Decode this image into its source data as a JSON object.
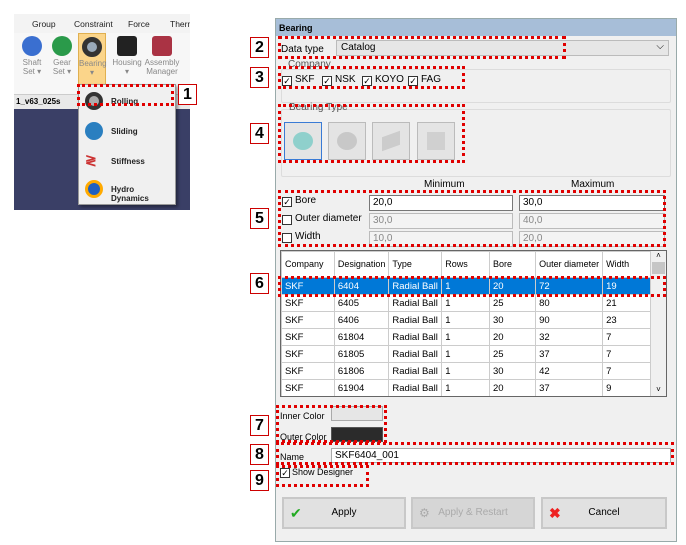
{
  "ribbon": {
    "tabs": [
      "Group",
      "Constraint",
      "Force",
      "Therm"
    ],
    "buttons": [
      {
        "label": "Shaft Set ▾",
        "icon": "shaft-icon"
      },
      {
        "label": "Gear Set ▾",
        "icon": "gear-icon"
      },
      {
        "label": "Bearing ▾",
        "icon": "bearing-icon"
      },
      {
        "label": "Housing ▾",
        "icon": "housing-icon"
      },
      {
        "label": "Assembly Manager",
        "icon": "assembly-icon"
      }
    ],
    "doc_tab": "1_v63_025s",
    "menu": [
      "Rolling",
      "Sliding",
      "Stiffness",
      "Hydro Dynamics"
    ]
  },
  "dialog": {
    "title": "Bearing",
    "data_type_label": "Data type",
    "data_type_value": "Catalog",
    "company_label": "Company",
    "companies": [
      {
        "name": "SKF",
        "checked": true
      },
      {
        "name": "NSK",
        "checked": true
      },
      {
        "name": "KOYO",
        "checked": true
      },
      {
        "name": "FAG",
        "checked": true
      }
    ],
    "bearing_type_label": "Bearing Type",
    "bearing_types": [
      "radial-ball-icon",
      "angular-ball-icon",
      "tapered-roller-icon",
      "cylindrical-roller-icon"
    ],
    "min_label": "Minimum",
    "max_label": "Maximum",
    "filters": [
      {
        "label": "Bore",
        "checked": true,
        "min": "20,0",
        "max": "30,0"
      },
      {
        "label": "Outer diameter",
        "checked": false,
        "min": "30,0",
        "max": "40,0"
      },
      {
        "label": "Width",
        "checked": false,
        "min": "10,0",
        "max": "20,0"
      }
    ],
    "table": {
      "columns": [
        "Company",
        "Designation",
        "Type",
        "Rows",
        "Bore",
        "Outer diameter",
        "Width"
      ],
      "rows": [
        [
          "SKF",
          "6404",
          "Radial Ball",
          "1",
          "20",
          "72",
          "19"
        ],
        [
          "SKF",
          "6405",
          "Radial Ball",
          "1",
          "25",
          "80",
          "21"
        ],
        [
          "SKF",
          "6406",
          "Radial Ball",
          "1",
          "30",
          "90",
          "23"
        ],
        [
          "SKF",
          "61804",
          "Radial Ball",
          "1",
          "20",
          "32",
          "7"
        ],
        [
          "SKF",
          "61805",
          "Radial Ball",
          "1",
          "25",
          "37",
          "7"
        ],
        [
          "SKF",
          "61806",
          "Radial Ball",
          "1",
          "30",
          "42",
          "7"
        ],
        [
          "SKF",
          "61904",
          "Radial Ball",
          "1",
          "20",
          "37",
          "9"
        ]
      ],
      "selected_row": 0
    },
    "inner_color_label": "Inner Color",
    "inner_color": "#e6e6e6",
    "outer_color_label": "Outer Color",
    "outer_color": "#2b2b2b",
    "name_label": "Name",
    "name_value": "SKF6404_001",
    "show_designer_label": "Show Designer",
    "show_designer": true,
    "apply": "Apply",
    "apply_restart": "Apply & Restart",
    "cancel": "Cancel"
  },
  "annotations": [
    "1",
    "2",
    "3",
    "4",
    "5",
    "6",
    "7",
    "8",
    "9"
  ],
  "colors": {
    "annotation": "#e00000",
    "selection": "#0078d7",
    "title_bar": "#a7bed8"
  }
}
